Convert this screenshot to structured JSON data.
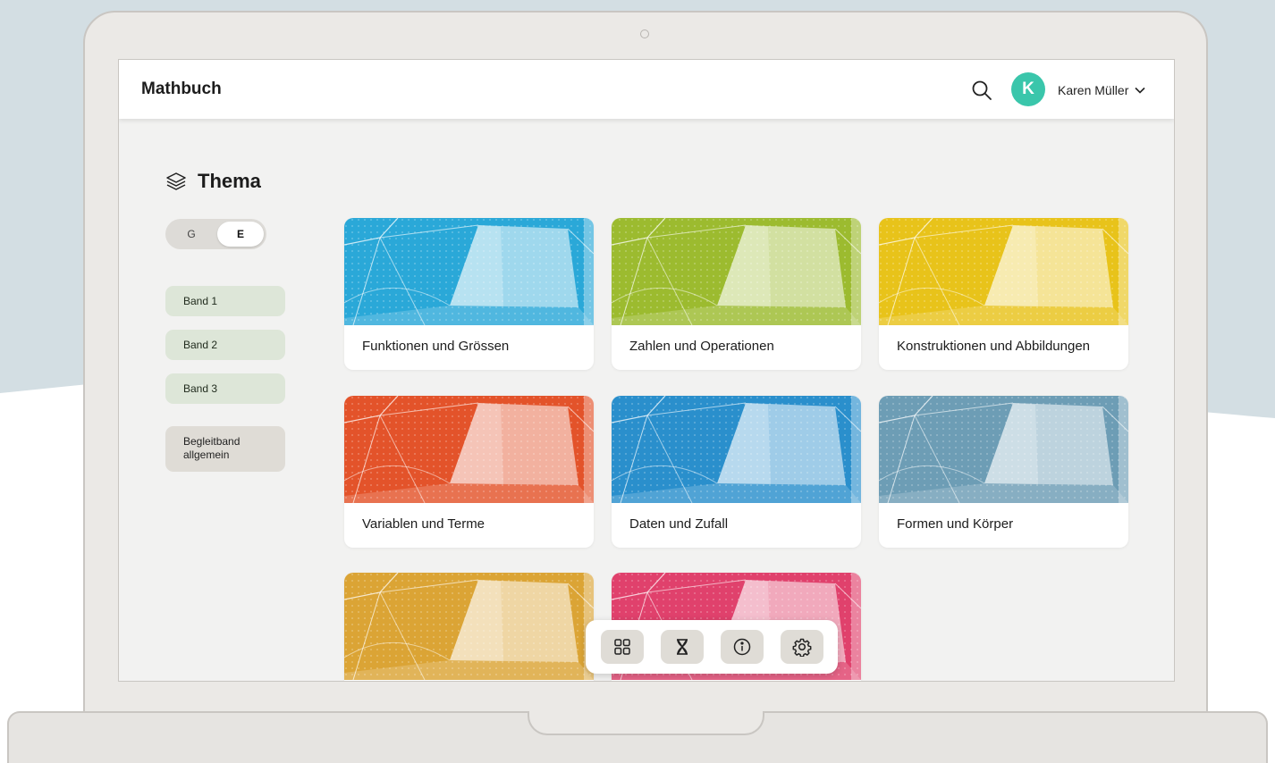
{
  "header": {
    "app_title": "Mathbuch",
    "user_initial": "K",
    "user_name": "Karen Müller"
  },
  "sidebar": {
    "section_title": "Thema",
    "level_toggle": {
      "options": [
        "G",
        "E"
      ],
      "selected": "E"
    },
    "bands": [
      "Band 1",
      "Band 2",
      "Band 3"
    ],
    "begleitband": [
      "Begleitband",
      "allgemein"
    ]
  },
  "topics": [
    {
      "title": "Funktionen und Grössen",
      "color": "#2aa8d8"
    },
    {
      "title": "Zahlen und Operationen",
      "color": "#9cbb2f"
    },
    {
      "title": "Konstruktionen und Abbildungen",
      "color": "#e8c31a"
    },
    {
      "title": "Variablen und Terme",
      "color": "#e3532a"
    },
    {
      "title": "Daten und Zufall",
      "color": "#2a8fcc"
    },
    {
      "title": "Formen und Körper",
      "color": "#6d9db5"
    },
    {
      "title": "",
      "color": "#dba435"
    },
    {
      "title": "",
      "color": "#e0416c"
    }
  ],
  "dock": {
    "icons": [
      "grid-icon",
      "hourglass-icon",
      "info-icon",
      "settings-icon"
    ]
  },
  "colors": {
    "accent_avatar": "#3ac6ab",
    "band_bg": "#dde6d8",
    "screen_bg": "#f2f2f1"
  }
}
